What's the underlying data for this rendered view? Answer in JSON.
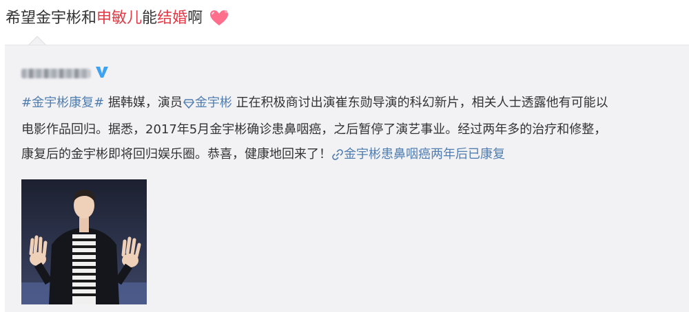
{
  "header": {
    "part1": "希望金宇彬和",
    "part2": "申敏儿",
    "part3": "能",
    "part4": "结婚",
    "part5": "啊",
    "heart_icon": "heart-icon",
    "highlight_color": "#e03a47"
  },
  "repost": {
    "author_verified_icon": "verified-icon",
    "topic": "#金宇彬康复#",
    "line1_a": " 据韩媒，演员",
    "mention": "金宇彬",
    "line1_b": " 正在积极商讨出演崔东勋导演的科幻新片，相关人士透露他有可能以",
    "line2": "电影作品回归。据悉，2017年5月金宇彬确诊患鼻咽癌，之后暂停了演艺事业。经过两年多的治疗和修整，",
    "line3": "康复后的金宇彬即将回归娱乐圈。恭喜，健康地回来了！",
    "link_text": "金宇彬患鼻咽癌两年后已康复",
    "link_icon": "link-icon",
    "link_color": "#507daf"
  }
}
